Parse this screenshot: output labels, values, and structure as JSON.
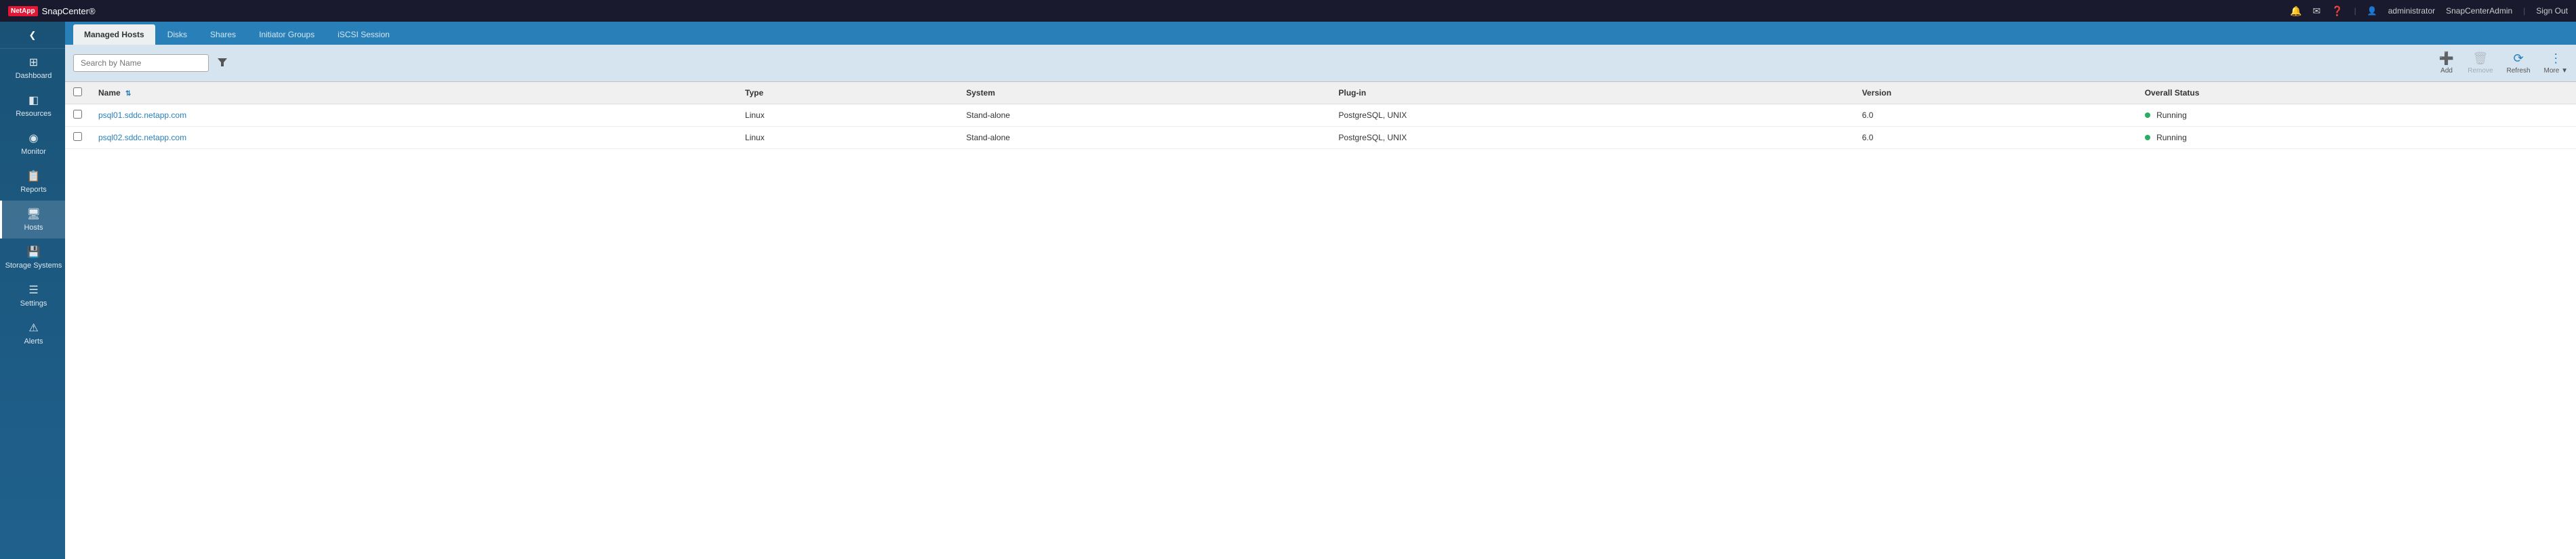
{
  "topBar": {
    "brand": "NetApp",
    "appName": "SnapCenter®",
    "icons": {
      "bell": "🔔",
      "mail": "✉",
      "help": "❓"
    },
    "user": "administrator",
    "tenant": "SnapCenterAdmin",
    "signOut": "Sign Out"
  },
  "sidebar": {
    "collapseIcon": "❮",
    "items": [
      {
        "id": "dashboard",
        "label": "Dashboard",
        "icon": "⊞",
        "active": false
      },
      {
        "id": "resources",
        "label": "Resources",
        "icon": "◧",
        "active": false
      },
      {
        "id": "monitor",
        "label": "Monitor",
        "icon": "◉",
        "active": false
      },
      {
        "id": "reports",
        "label": "Reports",
        "icon": "📋",
        "active": false
      },
      {
        "id": "hosts",
        "label": "Hosts",
        "icon": "🖥",
        "active": true
      },
      {
        "id": "storage-systems",
        "label": "Storage Systems",
        "icon": "💾",
        "active": false
      },
      {
        "id": "settings",
        "label": "Settings",
        "icon": "☰",
        "active": false
      },
      {
        "id": "alerts",
        "label": "Alerts",
        "icon": "⚠",
        "active": false
      }
    ]
  },
  "tabs": [
    {
      "id": "managed-hosts",
      "label": "Managed Hosts",
      "active": true
    },
    {
      "id": "disks",
      "label": "Disks",
      "active": false
    },
    {
      "id": "shares",
      "label": "Shares",
      "active": false
    },
    {
      "id": "initiator-groups",
      "label": "Initiator Groups",
      "active": false
    },
    {
      "id": "iscsi-session",
      "label": "iSCSI Session",
      "active": false
    }
  ],
  "toolbar": {
    "searchPlaceholder": "Search by Name",
    "filterIcon": "▼",
    "actions": [
      {
        "id": "add",
        "label": "Add",
        "icon": "+",
        "disabled": false
      },
      {
        "id": "remove",
        "label": "Remove",
        "icon": "🗑",
        "disabled": true
      },
      {
        "id": "refresh",
        "label": "Refresh",
        "icon": "⟳",
        "disabled": false
      },
      {
        "id": "more",
        "label": "More ▼",
        "icon": "⋮",
        "disabled": false
      }
    ]
  },
  "table": {
    "columns": [
      {
        "id": "checkbox",
        "label": "",
        "sortable": false
      },
      {
        "id": "name",
        "label": "Name",
        "sortable": true
      },
      {
        "id": "type",
        "label": "Type",
        "sortable": false
      },
      {
        "id": "system",
        "label": "System",
        "sortable": false
      },
      {
        "id": "plugin",
        "label": "Plug-in",
        "sortable": false
      },
      {
        "id": "version",
        "label": "Version",
        "sortable": false
      },
      {
        "id": "overall-status",
        "label": "Overall Status",
        "sortable": false
      }
    ],
    "rows": [
      {
        "name": "psql01.sddc.netapp.com",
        "type": "Linux",
        "system": "Stand-alone",
        "plugin": "PostgreSQL, UNIX",
        "version": "6.0",
        "status": "Running",
        "statusColor": "running"
      },
      {
        "name": "psql02.sddc.netapp.com",
        "type": "Linux",
        "system": "Stand-alone",
        "plugin": "PostgreSQL, UNIX",
        "version": "6.0",
        "status": "Running",
        "statusColor": "running"
      }
    ]
  }
}
